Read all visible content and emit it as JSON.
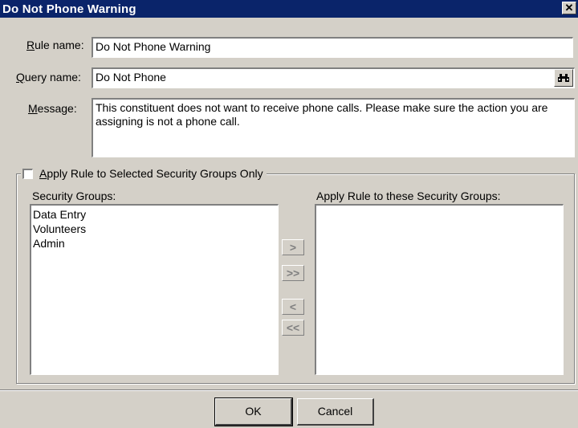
{
  "window": {
    "title": "Do Not Phone Warning",
    "close_glyph": "✕"
  },
  "form": {
    "rule_name_label_key": "R",
    "rule_name_label_rest": "ule name:",
    "rule_name_value": "Do Not Phone Warning",
    "query_name_label_key": "Q",
    "query_name_label_rest": "uery name:",
    "query_name_value": "Do Not Phone",
    "query_search_icon": "binoculars-icon",
    "message_label_key": "M",
    "message_label_rest": "essage:",
    "message_value": "This constituent does not want to receive phone calls. Please make sure the action you are assigning is not a phone call."
  },
  "security": {
    "apply_key": "A",
    "apply_rest": "pply Rule to Selected Security Groups Only",
    "apply_checked": false,
    "available_label": "Security Groups:",
    "selected_label": "Apply Rule to these Security Groups:",
    "available_groups": [
      "Data Entry",
      "Volunteers",
      "Admin"
    ],
    "selected_groups": [],
    "move_right": ">",
    "move_all_right": ">>",
    "move_left": "<",
    "move_all_left": "<<"
  },
  "buttons": {
    "ok": "OK",
    "cancel": "Cancel"
  }
}
